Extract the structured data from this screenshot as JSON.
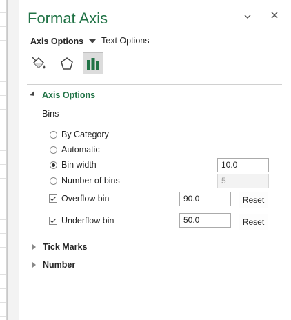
{
  "pane": {
    "title": "Format Axis",
    "tabs": {
      "axis_options": "Axis Options",
      "text_options": "Text Options"
    },
    "icons": [
      "fill-line-icon",
      "effects-icon",
      "axis-options-icon"
    ]
  },
  "axis_options_section": {
    "heading": "Axis Options",
    "bins_label": "Bins",
    "radios": [
      {
        "label": "By Category",
        "selected": false
      },
      {
        "label": "Automatic",
        "selected": false
      },
      {
        "label": "Bin width",
        "selected": true,
        "value": "10.0"
      },
      {
        "label": "Number of bins",
        "selected": false,
        "value": "5"
      }
    ],
    "overflow": {
      "label": "Overflow bin",
      "checked": true,
      "value": "90.0",
      "reset": "Reset"
    },
    "underflow": {
      "label": "Underflow bin",
      "checked": true,
      "value": "50.0",
      "reset": "Reset"
    }
  },
  "collapsed_sections": {
    "tick_marks": "Tick Marks",
    "number": "Number"
  },
  "colors": {
    "accent": "#217346",
    "selected_tab_bg": "#dcdcdc"
  }
}
